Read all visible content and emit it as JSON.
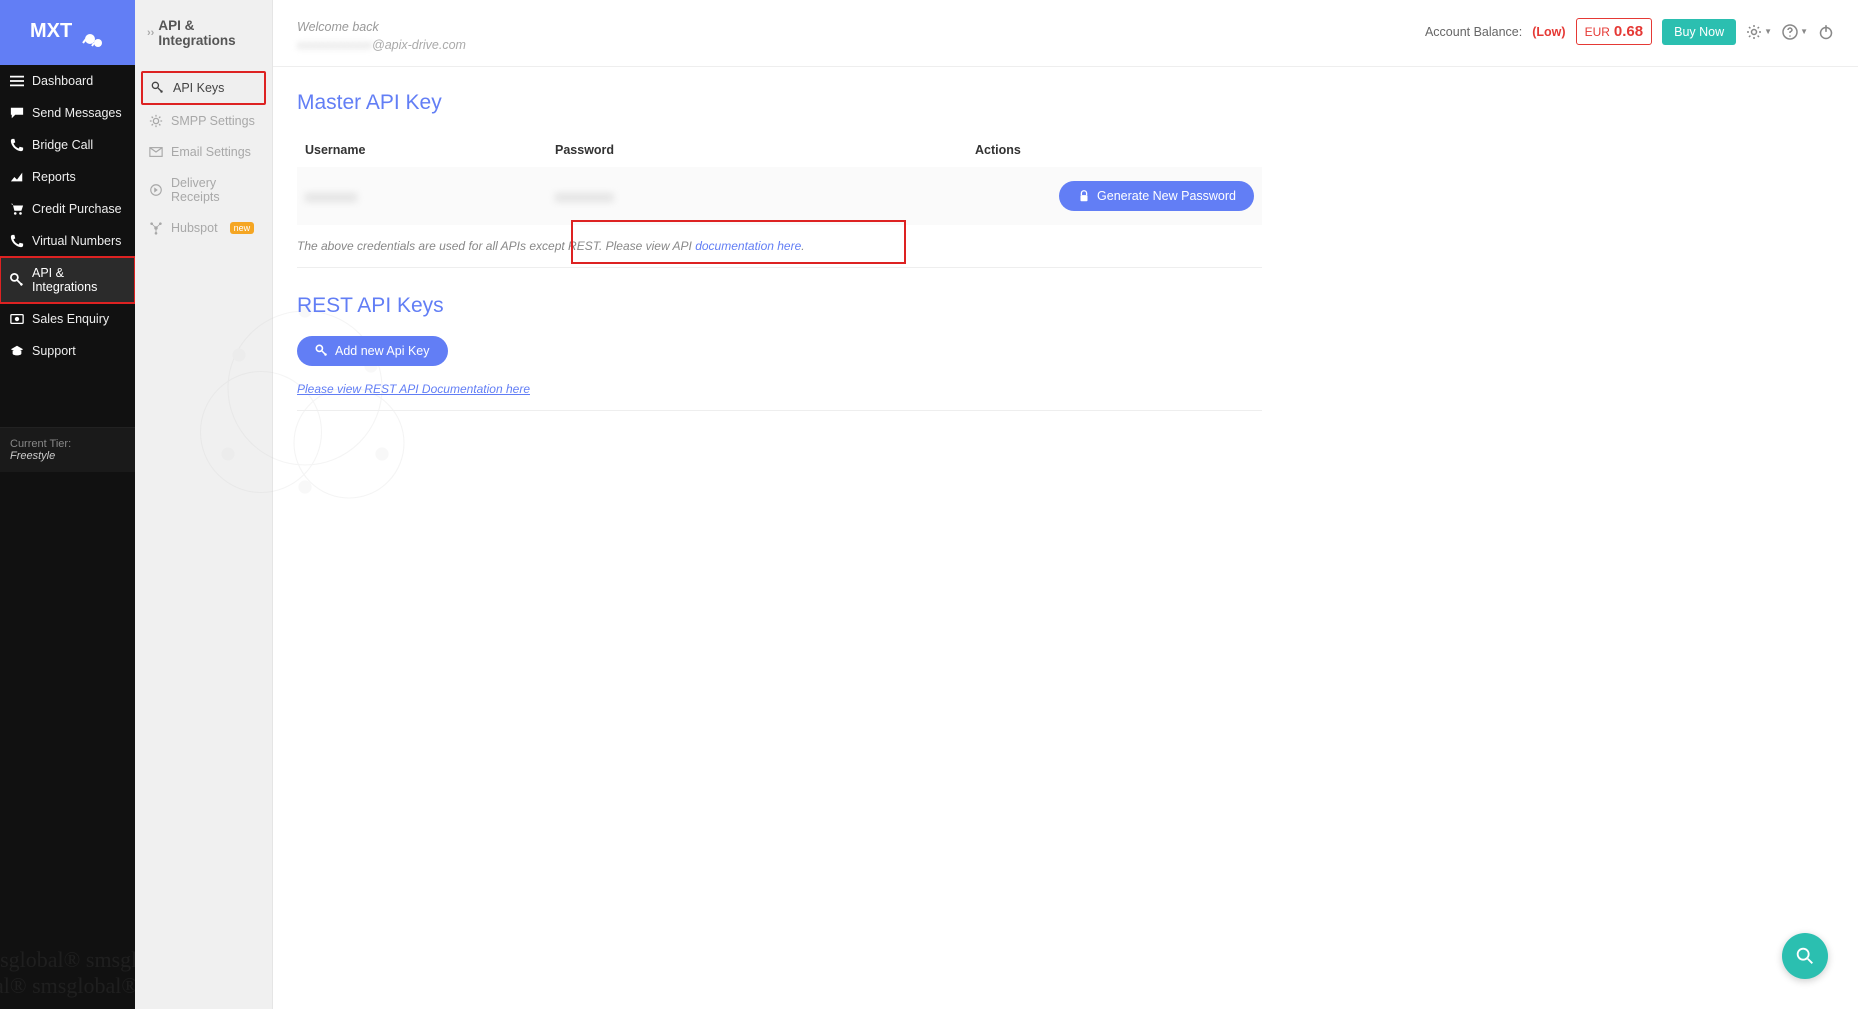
{
  "logo_text": "MXT",
  "nav": {
    "items": [
      {
        "label": "Dashboard"
      },
      {
        "label": "Send Messages"
      },
      {
        "label": "Bridge Call"
      },
      {
        "label": "Reports"
      },
      {
        "label": "Credit Purchase"
      },
      {
        "label": "Virtual Numbers"
      },
      {
        "label": "API & Integrations"
      },
      {
        "label": "Sales Enquiry"
      },
      {
        "label": "Support"
      }
    ]
  },
  "tier": {
    "label": "Current Tier:",
    "value": "Freestyle"
  },
  "subnav": {
    "title": "API & Integrations",
    "items": [
      {
        "label": "API Keys"
      },
      {
        "label": "SMPP Settings"
      },
      {
        "label": "Email Settings"
      },
      {
        "label": "Delivery Receipts"
      },
      {
        "label": "Hubspot",
        "badge": "new"
      }
    ]
  },
  "topbar": {
    "welcome": "Welcome back",
    "email_suffix": "@apix-drive.com",
    "balance_label": "Account Balance:",
    "balance_status": "(Low)",
    "currency": "EUR",
    "amount": "0.68",
    "buy": "Buy Now"
  },
  "master": {
    "heading": "Master API Key",
    "col_user": "Username",
    "col_pass": "Password",
    "col_actions": "Actions",
    "gen_btn": "Generate New Password",
    "note_prefix": "The above credentials are used for all APIs except REST. Please view API ",
    "note_link": "documentation here",
    "note_suffix": "."
  },
  "rest": {
    "heading": "REST API Keys",
    "add_btn": "Add new Api Key",
    "doc_link": "Please view REST API Documentation here"
  },
  "watermark_l1": "isglobal® smsglobal",
  "watermark_l2": "al® smsglobal® sm"
}
